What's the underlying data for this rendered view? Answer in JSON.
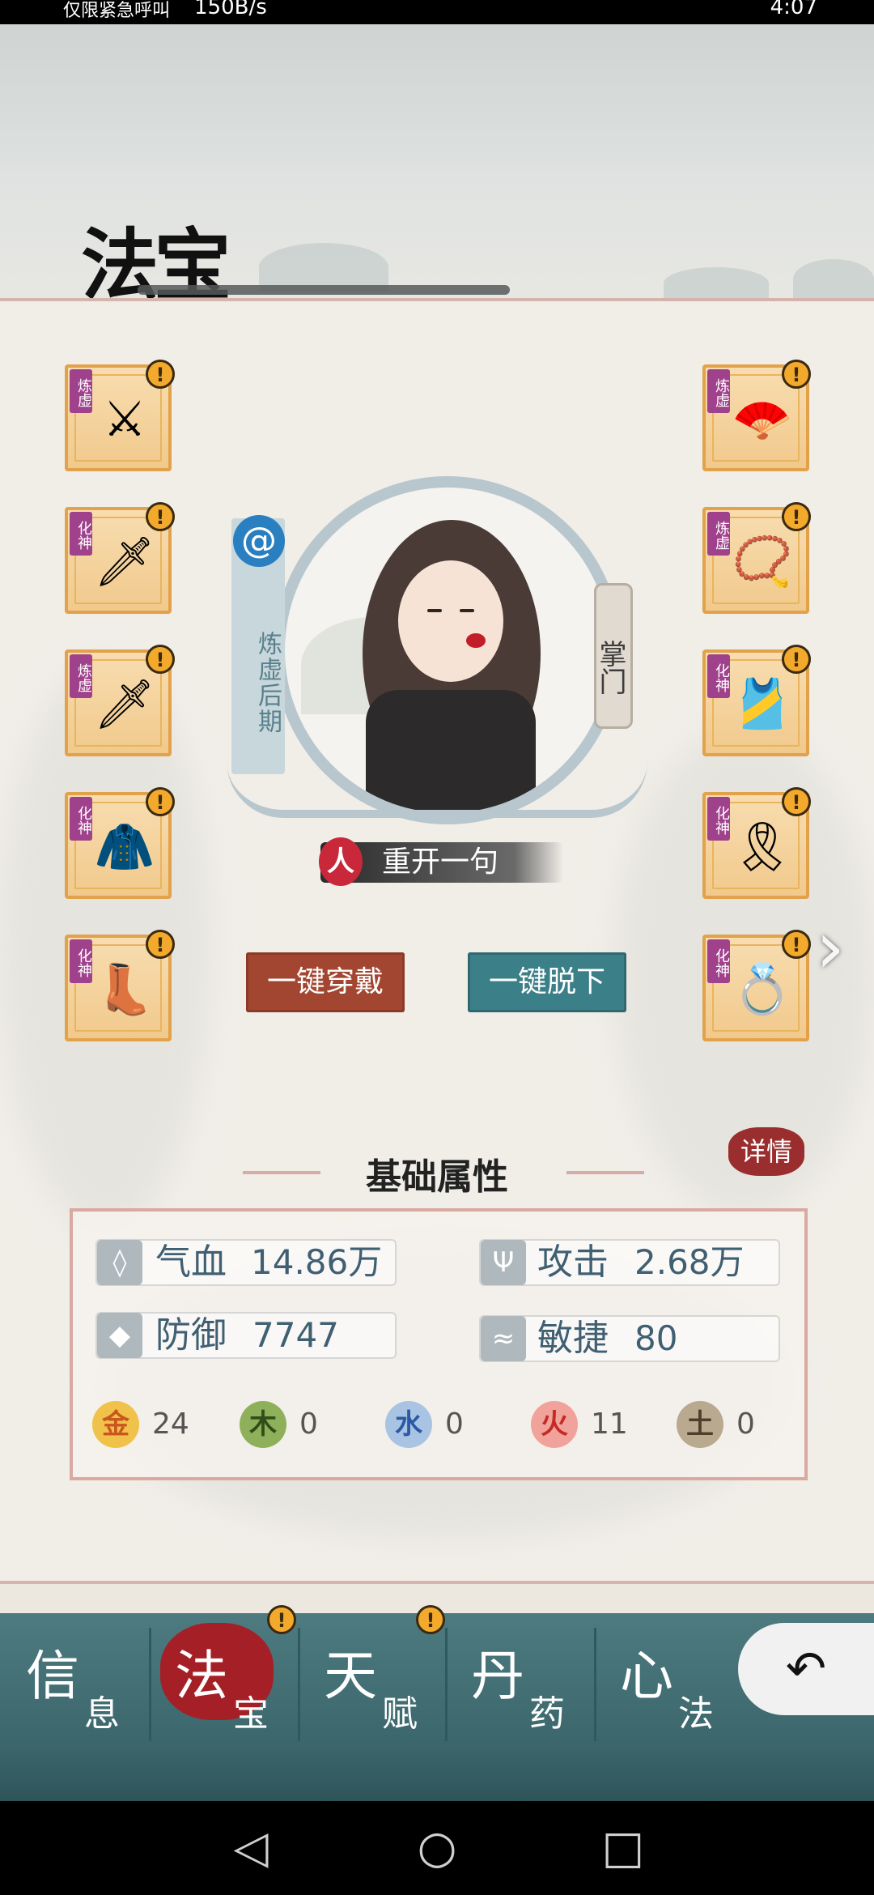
{
  "status_bar": {
    "carrier_text": "仅限紧急呼叫",
    "network_speed": "150B/s",
    "time": "4:07"
  },
  "header": {
    "title": "法宝"
  },
  "character": {
    "realm": "炼虚后期",
    "sect_role": "掌门",
    "race_badge": "人",
    "name": "重开一句"
  },
  "left_slots": [
    {
      "tag": "炼虚",
      "icon": "⚔",
      "alert": "!"
    },
    {
      "tag": "化神",
      "icon": "🗡",
      "alert": "!"
    },
    {
      "tag": "炼虚",
      "icon": "🗡",
      "alert": "!"
    },
    {
      "tag": "化神",
      "icon": "🧥",
      "alert": "!"
    },
    {
      "tag": "化神",
      "icon": "👢",
      "alert": "!"
    }
  ],
  "right_slots": [
    {
      "tag": "炼虚",
      "icon": "🪭",
      "alert": "!"
    },
    {
      "tag": "炼虚",
      "icon": "📿",
      "alert": "!"
    },
    {
      "tag": "化神",
      "icon": "🎽",
      "alert": "!"
    },
    {
      "tag": "化神",
      "icon": "🎗",
      "alert": "!"
    },
    {
      "tag": "化神",
      "icon": "💍",
      "alert": "!"
    }
  ],
  "actions": {
    "wear_all": "一键穿戴",
    "remove_all": "一键脱下",
    "next_icon": "›"
  },
  "stats": {
    "title": "基础属性",
    "details": "详情",
    "hp_label": "气血",
    "hp_value": "14.86万",
    "atk_label": "攻击",
    "atk_value": "2.68万",
    "def_label": "防御",
    "def_value": "7747",
    "agi_label": "敏捷",
    "agi_value": "80",
    "elements": [
      {
        "glyph": "金",
        "value": "24",
        "color": "#f0c24a",
        "text_color": "#c8561e"
      },
      {
        "glyph": "木",
        "value": "0",
        "color": "#8fb05a",
        "text_color": "#2f4e1a"
      },
      {
        "glyph": "水",
        "value": "0",
        "color": "#a9c3e3",
        "text_color": "#2b5aa5"
      },
      {
        "glyph": "火",
        "value": "11",
        "color": "#f1a39b",
        "text_color": "#c42a26"
      },
      {
        "glyph": "土",
        "value": "0",
        "color": "#b8a98f",
        "text_color": "#4d3f2c"
      }
    ]
  },
  "nav": {
    "items": [
      {
        "big": "信",
        "small": "息"
      },
      {
        "big": "法",
        "small": "宝"
      },
      {
        "big": "天",
        "small": "赋"
      },
      {
        "big": "丹",
        "small": "药"
      },
      {
        "big": "心",
        "small": "法"
      }
    ],
    "alert": "!",
    "back_icon": "↶"
  },
  "system_nav": {
    "back": "◁",
    "home": "○",
    "recent": "□"
  }
}
